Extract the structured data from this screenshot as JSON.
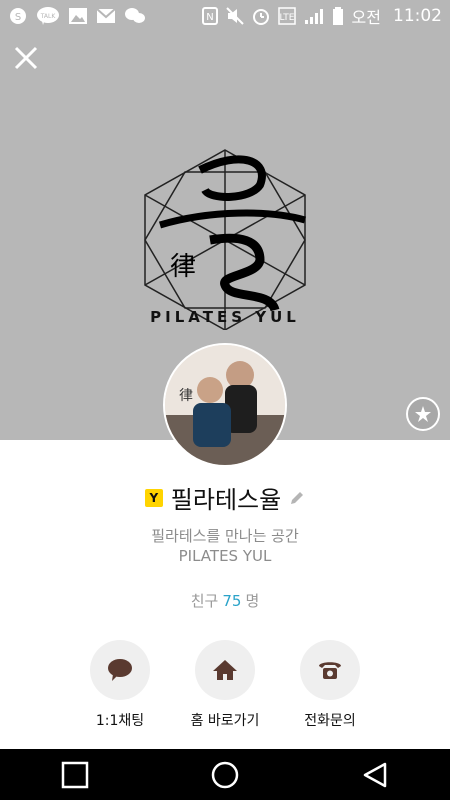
{
  "status_bar": {
    "ampm": "오전",
    "time": "11:02",
    "left_icons": [
      "kakao-story-icon",
      "kakaotalk-icon",
      "image-icon",
      "mail-icon",
      "chat-icon"
    ],
    "right_icons": [
      "nfc-icon",
      "mute-icon",
      "alarm-icon",
      "network-icon",
      "signal-icon",
      "battery-icon"
    ]
  },
  "profile": {
    "brand_wordmark": "PILATES YUL",
    "badge": "Y",
    "name": "필라테스율",
    "status_line1": "필라테스를 만나는 공간",
    "status_line2": "PILATES YUL",
    "friends_label": "친구",
    "friends_count": "75",
    "friends_unit": "명"
  },
  "actions": [
    {
      "label": "1:1채팅",
      "icon": "chat-bubble-icon"
    },
    {
      "label": "홈 바로가기",
      "icon": "home-icon"
    },
    {
      "label": "전화문의",
      "icon": "phone-icon"
    }
  ],
  "colors": {
    "cover_bg": "#b7b7b7",
    "accent_count": "#2aa3c9",
    "badge_yellow": "#ffd400",
    "action_icon": "#5a3a30"
  }
}
